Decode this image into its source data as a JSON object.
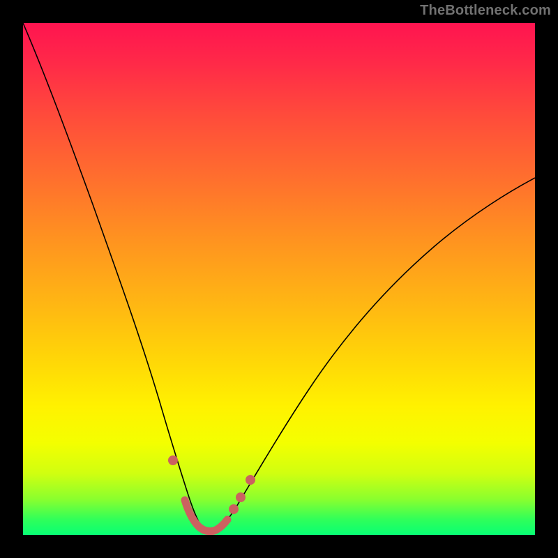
{
  "watermark": "TheBottleneck.com",
  "colors": {
    "page_bg": "#000000",
    "gradient_top": "#ff1450",
    "gradient_bottom": "#08ff74",
    "curve": "#000000",
    "markers": "#cb6160",
    "watermark": "#717171"
  },
  "chart_data": {
    "type": "line",
    "title": "",
    "xlabel": "",
    "ylabel": "",
    "xlim": [
      0,
      100
    ],
    "ylim": [
      0,
      100
    ],
    "grid": false,
    "note": "Chart has no axis ticks or labels; x and y are normalized 0–100 to describe curve shape. Low y = near bottom (green).",
    "series": [
      {
        "name": "bottleneck-curve",
        "x": [
          0,
          5,
          10,
          15,
          20,
          24,
          27,
          30,
          32,
          34,
          35,
          37,
          40,
          45,
          50,
          55,
          60,
          70,
          80,
          90,
          100
        ],
        "y": [
          100,
          90,
          78,
          64,
          49,
          34,
          22,
          11,
          5,
          1,
          0,
          1,
          3,
          9,
          17,
          26,
          33,
          46,
          56,
          63,
          68
        ]
      }
    ],
    "markers": [
      {
        "name": "left-dot",
        "x": 29.0,
        "y": 14.0
      },
      {
        "name": "trail-start",
        "x": 31.5,
        "y": 6.5
      },
      {
        "name": "trail-end",
        "x": 37.5,
        "y": 2.0
      },
      {
        "name": "right-dot-1",
        "x": 39.0,
        "y": 4.0
      },
      {
        "name": "right-dot-2",
        "x": 40.5,
        "y": 6.5
      },
      {
        "name": "right-dot-3",
        "x": 42.5,
        "y": 10.5
      }
    ],
    "legend": null
  }
}
